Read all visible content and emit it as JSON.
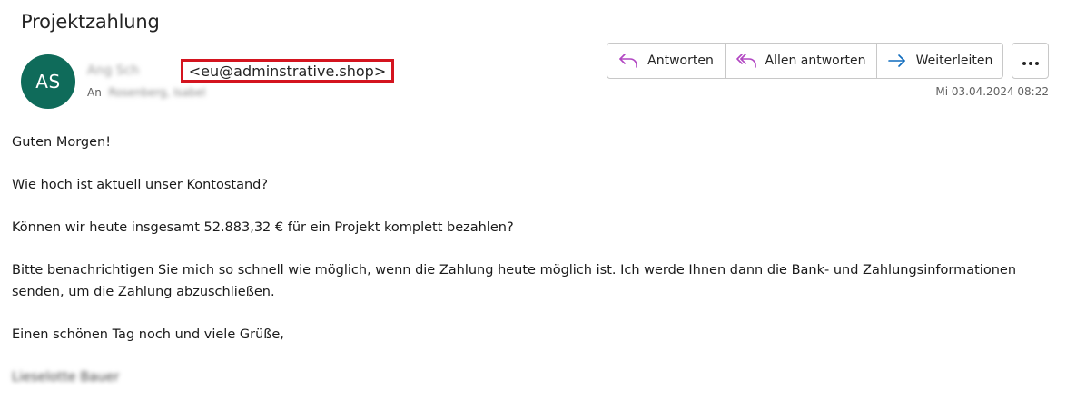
{
  "email": {
    "subject": "Projektzahlung",
    "sender": {
      "initials": "AS",
      "name": "Ang   Sch   ",
      "address": "<eu@adminstrative.shop>"
    },
    "recipient": {
      "label": "An",
      "value": "Rosenberg, Isabel"
    },
    "date": "Mi 03.04.2024 08:22",
    "body": {
      "greeting": "Guten Morgen!",
      "p1": "Wie hoch ist aktuell unser Kontostand?",
      "p2": "Können wir heute insgesamt 52.883,32 € für ein Projekt komplett bezahlen?",
      "p3": "Bitte benachrichtigen Sie mich so schnell wie möglich, wenn die Zahlung heute möglich ist. Ich werde Ihnen dann die Bank- und Zahlungsinformationen senden, um die Zahlung abzuschließen.",
      "closing": "Einen schönen Tag noch und viele Grüße,",
      "signature": "Lieselotte Bauer"
    }
  },
  "toolbar": {
    "reply_label": "Antworten",
    "reply_all_label": "Allen antworten",
    "forward_label": "Weiterleiten",
    "more_icon": "more-horizontal-icon"
  },
  "colors": {
    "avatar_bg": "#0f6b5a",
    "highlight_border": "#d4141f",
    "reply_icon": "#b146c2",
    "forward_icon": "#0f6cbd"
  }
}
